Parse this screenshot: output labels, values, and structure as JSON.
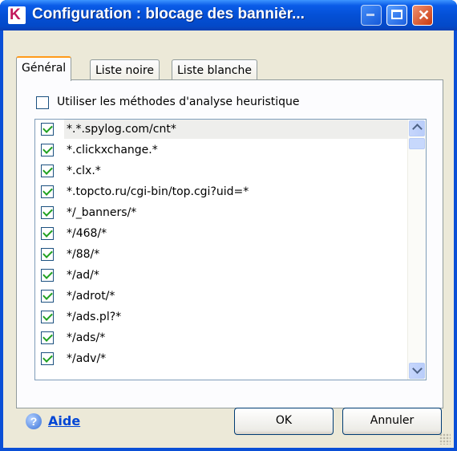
{
  "window": {
    "title": "Configuration : blocage des bannièr...",
    "app_icon_letter": "K"
  },
  "tabs": [
    {
      "label": "Général",
      "active": true
    },
    {
      "label": "Liste noire",
      "active": false
    },
    {
      "label": "Liste blanche",
      "active": false
    }
  ],
  "heuristic": {
    "label": "Utiliser les méthodes d'analyse heuristique",
    "checked": false
  },
  "list": {
    "items": [
      {
        "text": "*.*.spylog.com/cnt*",
        "checked": true,
        "selected": true
      },
      {
        "text": "*.clickxchange.*",
        "checked": true
      },
      {
        "text": "*.clx.*",
        "checked": true
      },
      {
        "text": "*.topcto.ru/cgi-bin/top.cgi?uid=*",
        "checked": true
      },
      {
        "text": "*/_banners/*",
        "checked": true
      },
      {
        "text": "*/468/*",
        "checked": true
      },
      {
        "text": "*/88/*",
        "checked": true
      },
      {
        "text": "*/ad/*",
        "checked": true
      },
      {
        "text": "*/adrot/*",
        "checked": true
      },
      {
        "text": "*/ads.pl?*",
        "checked": true
      },
      {
        "text": "*/ads/*",
        "checked": true
      },
      {
        "text": "*/adv/*",
        "checked": true
      }
    ]
  },
  "footer": {
    "help_label": "Aide",
    "ok_label": "OK",
    "cancel_label": "Annuler"
  },
  "colors": {
    "titlebar": "#0450d6",
    "dialog_bg": "#ece9d8",
    "check_mark": "#21a121",
    "link": "#0046d5",
    "active_tab_accent": "#ff9a1a"
  }
}
